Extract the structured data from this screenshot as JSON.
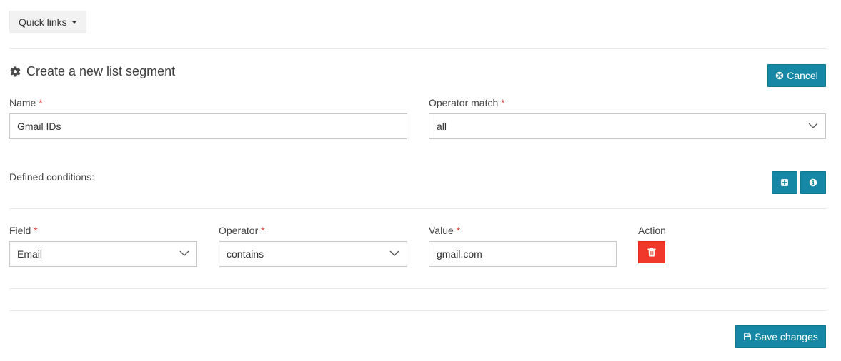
{
  "quick_links": {
    "label": "Quick links"
  },
  "page": {
    "title": "Create a new list segment"
  },
  "cancel_button": {
    "label": "Cancel"
  },
  "form": {
    "name_label": "Name",
    "name_value": "Gmail IDs",
    "operator_match_label": "Operator match",
    "operator_match_value": "all",
    "required_marker": "*"
  },
  "conditions": {
    "heading": "Defined conditions:",
    "field_label": "Field",
    "operator_label": "Operator",
    "value_label": "Value",
    "action_label": "Action",
    "rows": [
      {
        "field": "Email",
        "operator": "contains",
        "value": "gmail.com"
      }
    ]
  },
  "save_button": {
    "label": "Save changes"
  },
  "colors": {
    "accent": "#1688a5",
    "danger": "#f0392b",
    "required": "#d64545"
  },
  "icons": {
    "title": "gear-icon",
    "cancel": "times-circle-icon",
    "add": "plus-square-icon",
    "info": "info-circle-icon",
    "delete": "trash-icon",
    "save": "floppy-disk-icon",
    "select": "chevron-down-icon"
  }
}
